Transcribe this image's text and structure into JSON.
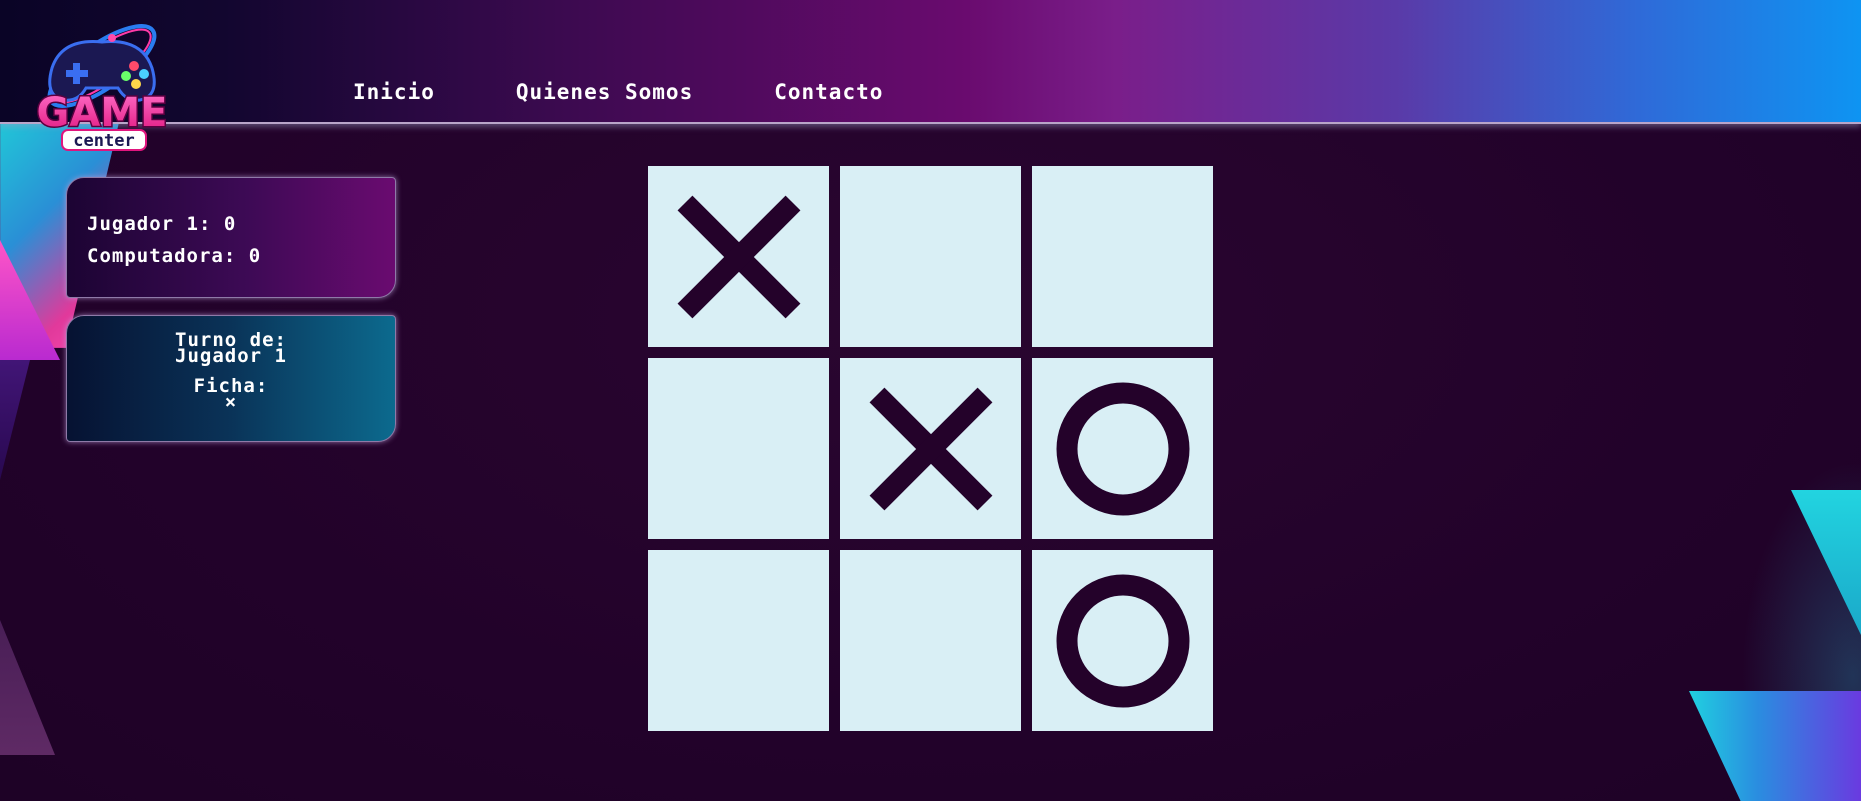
{
  "header": {
    "nav": [
      "Inicio",
      "Quienes Somos",
      "Contacto"
    ],
    "logo_text": [
      "GAME",
      "center"
    ]
  },
  "score": {
    "player_label": "Jugador 1: 0",
    "computer_label": "Computadora: 0"
  },
  "turn": {
    "turn_label": "Turno de:",
    "turn_player": "Jugador 1",
    "piece_label": "Ficha:",
    "piece_value": "×"
  },
  "board": {
    "cells": [
      "X",
      "",
      "",
      "",
      "X",
      "O",
      "",
      "",
      "O"
    ]
  },
  "colors": {
    "board_cell": "#d9eff5",
    "mark": "#24022a",
    "background": "#24022a"
  }
}
